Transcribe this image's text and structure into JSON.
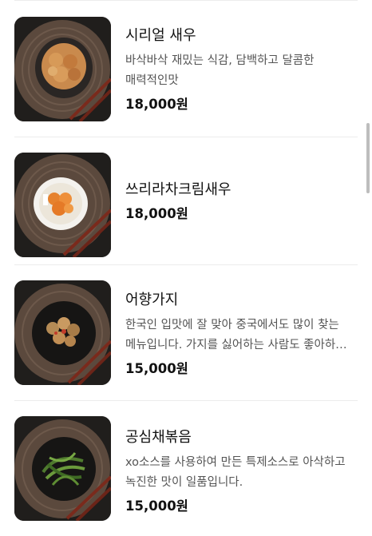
{
  "menu": {
    "items": [
      {
        "name": "시리얼 새우",
        "description": "바삭바삭 재밌는 식감, 담백하고 달콤한 매력적인맛",
        "price": "18,000원",
        "image": "cereal-shrimp-dish"
      },
      {
        "name": "쓰리라차크림새우",
        "description": "",
        "price": "18,000원",
        "image": "sriracha-cream-shrimp-dish"
      },
      {
        "name": "어향가지",
        "description": "한국인 입맛에 잘 맞아 중국에서도 많이 찾는 메뉴입니다. 가지를 싫어하는 사람도 좋아하는 메뉴",
        "price": "15,000원",
        "image": "fish-flavored-eggplant-dish"
      },
      {
        "name": "공심채볶음",
        "description": "xo소스를 사용하여 만든 특제소스로 아삭하고 녹진한 맛이 일품입니다.",
        "price": "15,000원",
        "image": "stir-fried-morning-glory-dish"
      }
    ]
  },
  "colors": {
    "background": "#ffffff",
    "text": "#111111",
    "description": "#555555",
    "divider": "#ececec",
    "placemat": "#5e4b3f"
  }
}
